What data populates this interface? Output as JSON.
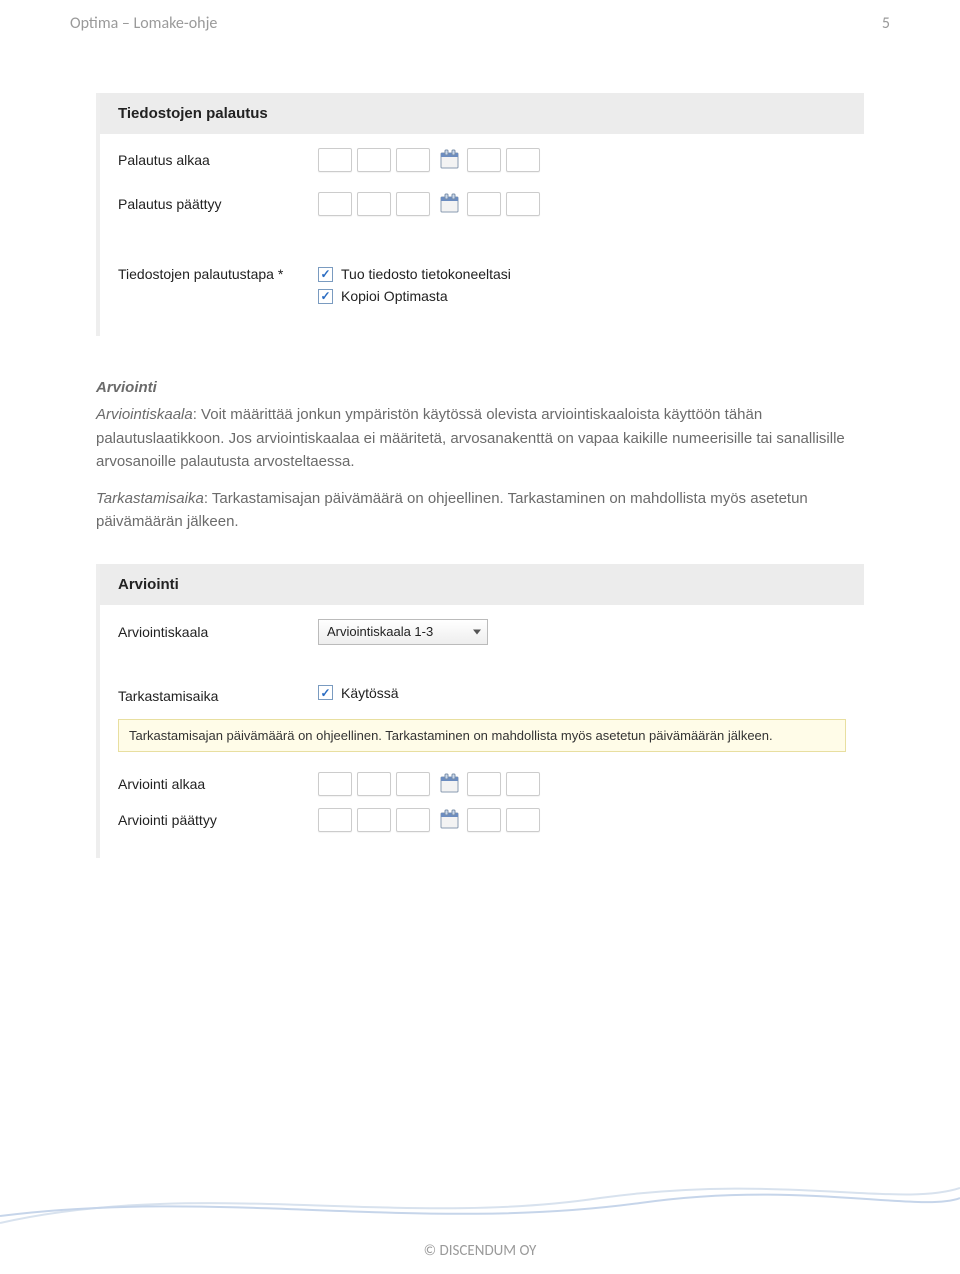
{
  "header": {
    "title": "Optima – Lomake-ohje",
    "page_number": "5"
  },
  "panel1": {
    "title": "Tiedostojen palautus",
    "row1_label": "Palautus alkaa",
    "row2_label": "Palautus päättyy",
    "row3_label": "Tiedostojen palautustapa *",
    "checkbox1_label": "Tuo tiedosto tietokoneeltasi",
    "checkbox2_label": "Kopioi Optimasta"
  },
  "bodytext": {
    "section_title": "Arviointi",
    "p1_term": "Arviointiskaala",
    "p1_rest": ": Voit määrittää jonkun ympäristön käytössä olevista arviointiskaaloista käyttöön tähän palautuslaatikkoon. Jos arviointiskaalaa ei määritetä, arvosanakenttä on vapaa kaikille numeerisille tai sanallisille arvosanoille palautusta arvosteltaessa.",
    "p2_term": "Tarkastamisaika",
    "p2_rest": ": Tarkastamisajan päivämäärä on ohjeellinen. Tarkastaminen on mahdollista myös asetetun päivämäärän jälkeen."
  },
  "panel2": {
    "title": "Arviointi",
    "row1_label": "Arviointiskaala",
    "select_value": "Arviointiskaala 1-3",
    "row2_label": "Tarkastamisaika",
    "checkbox_label": "Käytössä",
    "info_text": "Tarkastamisajan päivämäärä on ohjeellinen. Tarkastaminen on mahdollista myös asetetun päivämäärän jälkeen.",
    "row3_label": "Arviointi alkaa",
    "row4_label": "Arviointi päättyy"
  },
  "footer": {
    "text": "© DISCENDUM OY"
  }
}
